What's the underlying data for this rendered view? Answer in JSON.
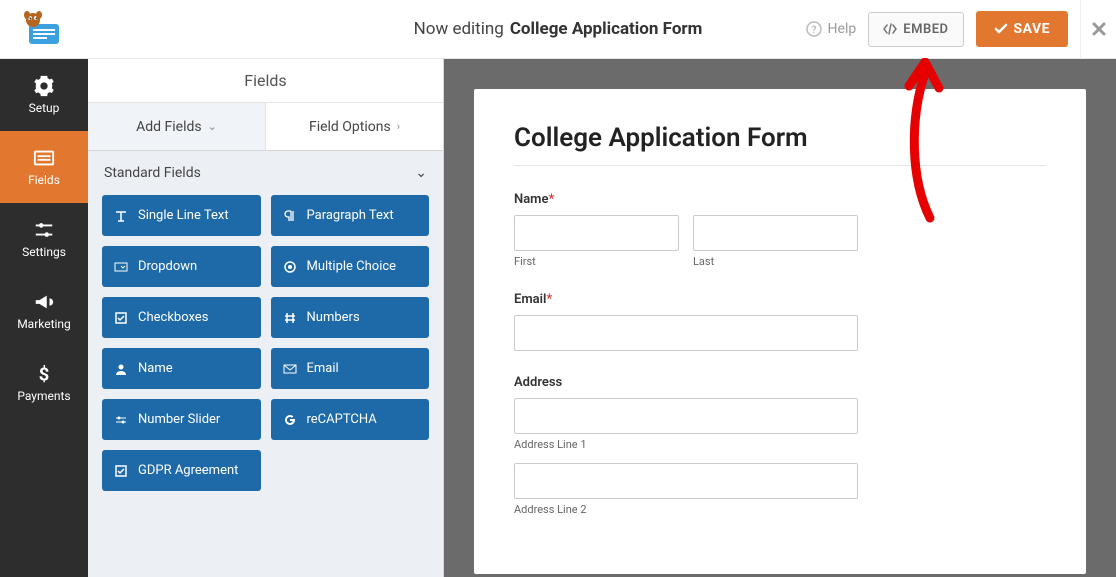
{
  "header": {
    "editing_prefix": "Now editing",
    "form_name": "College Application Form",
    "help": "Help",
    "embed": "EMBED",
    "save": "SAVE"
  },
  "sidebar": {
    "items": [
      {
        "label": "Setup"
      },
      {
        "label": "Fields"
      },
      {
        "label": "Settings"
      },
      {
        "label": "Marketing"
      },
      {
        "label": "Payments"
      }
    ]
  },
  "panel": {
    "header": "Fields",
    "tabs": {
      "add": "Add Fields",
      "options": "Field Options"
    },
    "group_title": "Standard Fields",
    "fields": [
      "Single Line Text",
      "Paragraph Text",
      "Dropdown",
      "Multiple Choice",
      "Checkboxes",
      "Numbers",
      "Name",
      "Email",
      "Number Slider",
      "reCAPTCHA",
      "GDPR Agreement"
    ]
  },
  "form": {
    "title": "College Application Form",
    "name_label": "Name",
    "first": "First",
    "last": "Last",
    "email_label": "Email",
    "address_label": "Address",
    "addr1": "Address Line 1",
    "addr2": "Address Line 2",
    "required_marker": "*"
  }
}
